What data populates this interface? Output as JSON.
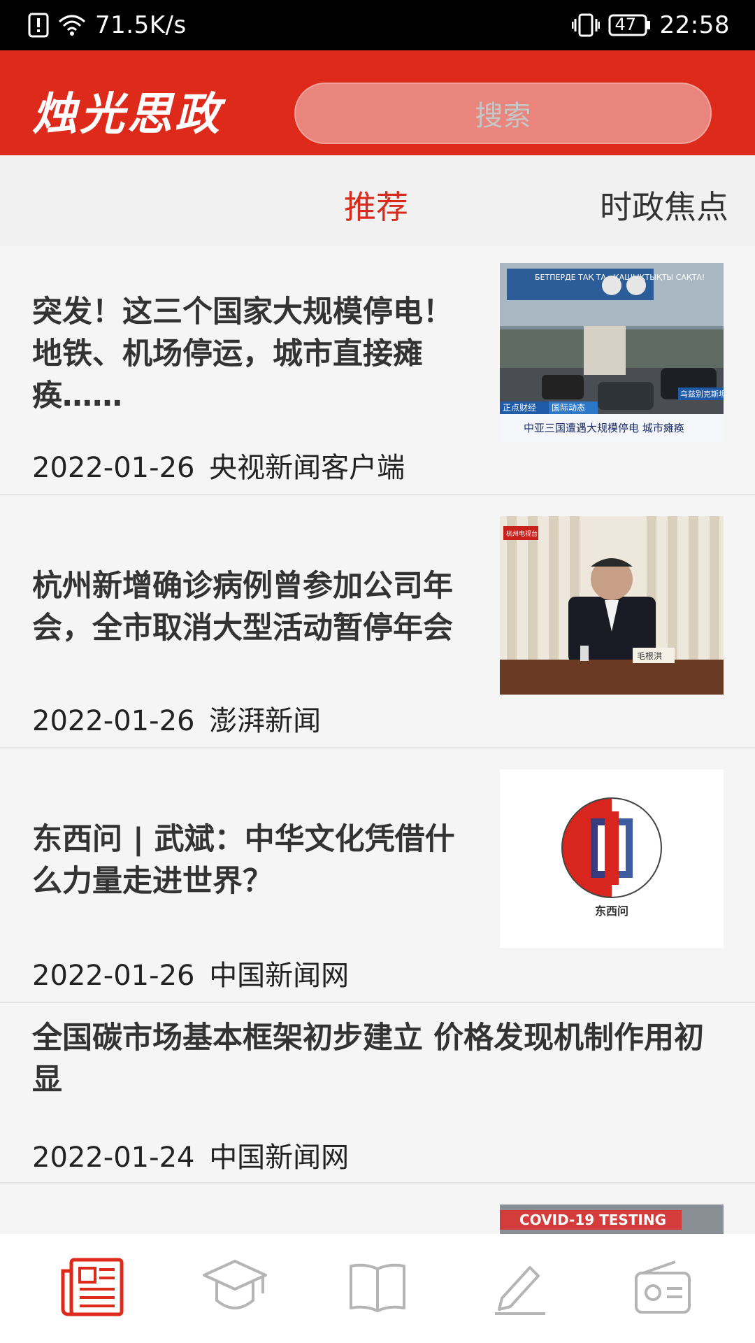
{
  "statusbar": {
    "speed": "71.5K/s",
    "battery": "47",
    "time": "22:58"
  },
  "header": {
    "logo": "烛光思政",
    "search_placeholder": "搜索"
  },
  "tabs": [
    {
      "label": "推荐",
      "active": true
    },
    {
      "label": "时政焦点",
      "active": false
    }
  ],
  "news": [
    {
      "title": "突发！这三个国家大规模停电！地铁、机场停运，城市直接瘫痪……",
      "date": "2022-01-26",
      "source": "央视新闻客户端",
      "thumb_caption": "中亚三国遭遇大规模停电 城市瘫痪",
      "thumb_tag1": "正点财经",
      "thumb_tag2": "国际动态",
      "thumb_location": "乌兹别克斯坦",
      "thumb_banner": "БЕТПЕРДЕ ТАҚ ТА - ҚАШЫҚТЫҚТЫ САҚТА!"
    },
    {
      "title": "杭州新增确诊病例曾参加公司年会，全市取消大型活动暂停年会",
      "date": "2022-01-26",
      "source": "澎湃新闻",
      "thumb_nameplate": "毛根洪",
      "thumb_logo": "杭州电视台"
    },
    {
      "title": "东西问 | 武斌：中华文化凭借什么力量走进世界？",
      "date": "2022-01-26",
      "source": "中国新闻网",
      "thumb_logo_text": "东西问"
    },
    {
      "title": "全国碳市场基本框架初步建立 价格发现机制作用初显",
      "date": "2022-01-24",
      "source": "中国新闻网"
    }
  ],
  "partial_thumb": {
    "label": "COVID-19 TESTING"
  },
  "bottom_nav": [
    {
      "icon": "news-icon",
      "active": true
    },
    {
      "icon": "graduation-cap-icon",
      "active": false
    },
    {
      "icon": "book-icon",
      "active": false
    },
    {
      "icon": "pencil-icon",
      "active": false
    },
    {
      "icon": "radio-icon",
      "active": false
    }
  ],
  "colors": {
    "brand_red": "#dd2a1b",
    "inactive_gray": "#b5b5b5"
  }
}
